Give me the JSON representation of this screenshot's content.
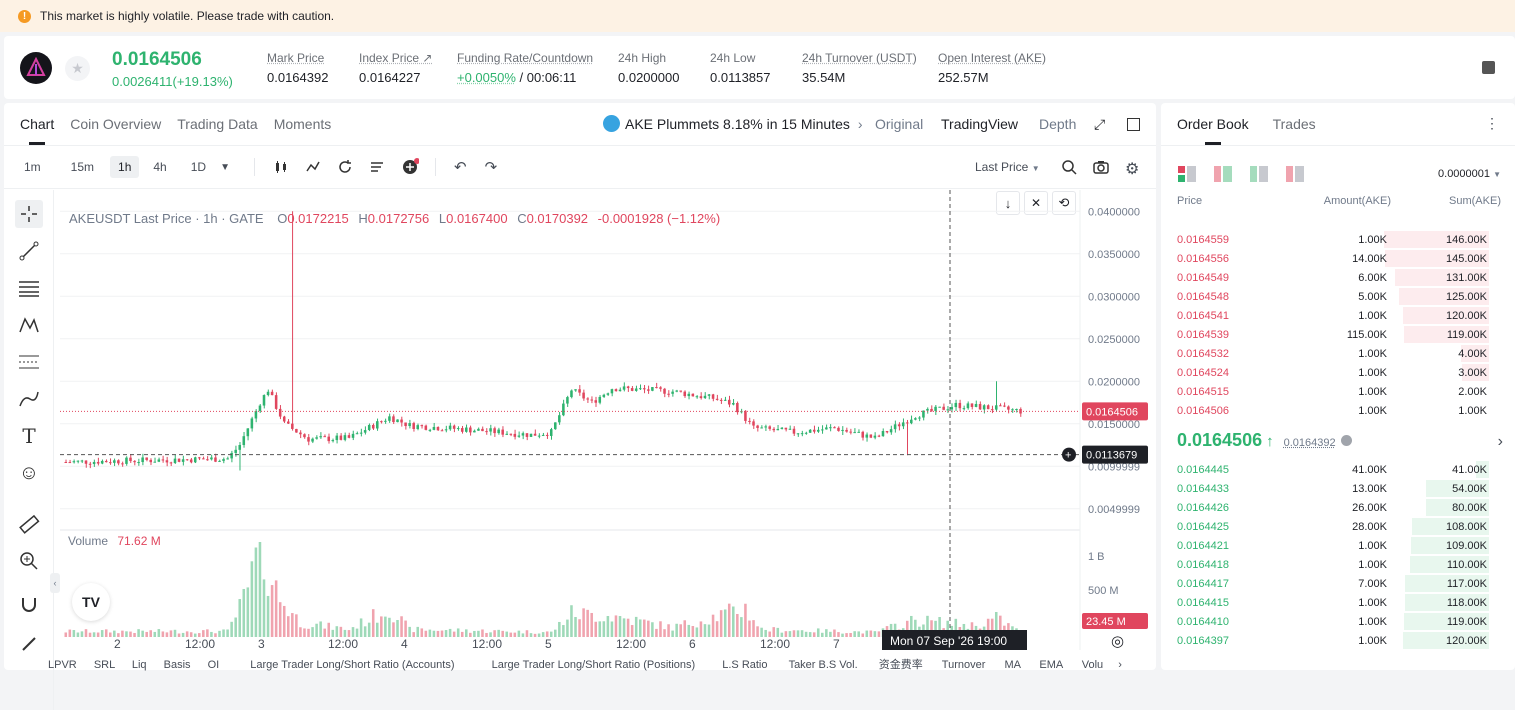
{
  "banner": {
    "text": "This market is highly volatile. Please trade with caution."
  },
  "ticker": {
    "last_price": "0.0164506",
    "change": "0.0026411(+19.13%)",
    "stats": [
      {
        "label": "Mark Price",
        "value": "0.0164392"
      },
      {
        "label": "Index Price ↗",
        "value": "0.0164227"
      },
      {
        "label": "Funding Rate/Countdown",
        "value_pos": "+0.0050%",
        "value_rest": " / 00:06:11"
      },
      {
        "label": "24h High",
        "value": "0.0200000"
      },
      {
        "label": "24h Low",
        "value": "0.0113857"
      },
      {
        "label": "24h Turnover (USDT)",
        "value": "35.54M"
      },
      {
        "label": "Open Interest (AKE)",
        "value": "252.57M"
      }
    ]
  },
  "chart_panel": {
    "tabs": [
      "Chart",
      "Coin Overview",
      "Trading Data",
      "Moments"
    ],
    "news": "AKE Plummets 8.18% in 15 Minutes",
    "view_tabs": [
      "Original",
      "TradingView",
      "Depth"
    ],
    "timeframes": [
      "1m",
      "15m",
      "1h",
      "4h",
      "1D"
    ],
    "price_type": "Last Price"
  },
  "chart_data": {
    "type": "candlestick",
    "symbol": "AKEUSDT Last Price · 1h · GATE",
    "ohlc": {
      "o_label": "O",
      "o": "0.0172215",
      "h_label": "H",
      "h": "0.0172756",
      "l_label": "L",
      "l": "0.0167400",
      "c_label": "C",
      "c": "0.0170392",
      "chg": "-0.0001928 (−1.12%)"
    },
    "y_ticks": [
      "0.0400000",
      "0.0350000",
      "0.0300000",
      "0.0250000",
      "0.0200000",
      "0.0150000",
      "0.0099999",
      "0.0049999"
    ],
    "x_ticks": [
      "2",
      "12:00",
      "3",
      "12:00",
      "4",
      "12:00",
      "5",
      "12:00",
      "6",
      "12:00",
      "7",
      "12:00"
    ],
    "last_price_tag": "0.0164506",
    "cross_price_tag": "0.0113679",
    "cross_time_tag": "Mon 07 Sep '26",
    "cross_time_hour": "19:00",
    "volume_label": "Volume",
    "volume_value": "71.62 M",
    "vol_ticks": [
      "1 B",
      "500 M"
    ],
    "vol_tag": "23.45 M",
    "ylim": [
      0.0025,
      0.0425
    ],
    "anchors": [
      [
        0,
        0.0105
      ],
      [
        40,
        0.0109
      ],
      [
        43,
        0.0125
      ],
      [
        48,
        0.0175
      ],
      [
        50,
        0.019
      ],
      [
        54,
        0.015
      ],
      [
        60,
        0.0132
      ],
      [
        70,
        0.0133
      ],
      [
        80,
        0.0158
      ],
      [
        85,
        0.0148
      ],
      [
        100,
        0.0143
      ],
      [
        115,
        0.0137
      ],
      [
        120,
        0.014
      ],
      [
        125,
        0.019
      ],
      [
        130,
        0.0175
      ],
      [
        135,
        0.0192
      ],
      [
        150,
        0.0188
      ],
      [
        160,
        0.018
      ],
      [
        165,
        0.0173
      ],
      [
        170,
        0.0145
      ],
      [
        180,
        0.014
      ],
      [
        190,
        0.0145
      ],
      [
        200,
        0.0133
      ],
      [
        210,
        0.016
      ],
      [
        220,
        0.0172
      ],
      [
        230,
        0.0168
      ],
      [
        236,
        0.0165
      ]
    ],
    "volume_anchors": [
      [
        0,
        0.06
      ],
      [
        40,
        0.06
      ],
      [
        43,
        0.3
      ],
      [
        45,
        0.5
      ],
      [
        48,
        0.95
      ],
      [
        50,
        0.7
      ],
      [
        53,
        0.4
      ],
      [
        58,
        0.15
      ],
      [
        70,
        0.08
      ],
      [
        80,
        0.3
      ],
      [
        85,
        0.08
      ],
      [
        120,
        0.05
      ],
      [
        125,
        0.25
      ],
      [
        135,
        0.22
      ],
      [
        150,
        0.1
      ],
      [
        168,
        0.3
      ],
      [
        172,
        0.08
      ],
      [
        200,
        0.05
      ],
      [
        210,
        0.18
      ],
      [
        225,
        0.12
      ],
      [
        230,
        0.2
      ],
      [
        236,
        0.05
      ]
    ]
  },
  "bottom_tools": [
    "LPVR",
    "SRL",
    "Liq",
    "Basis",
    "OI",
    "Large Trader Long/Short Ratio (Accounts)",
    "Large Trader Long/Short Ratio (Positions)",
    "L.S Ratio",
    "Taker B.S Vol.",
    "资金费率",
    "Turnover",
    "MA",
    "EMA",
    "Volu"
  ],
  "orderbook": {
    "tabs": [
      "Order Book",
      "Trades"
    ],
    "precision": "0.0000001",
    "headers": [
      "Price",
      "Amount(AKE)",
      "Sum(AKE)"
    ],
    "asks": [
      {
        "p": "0.0164559",
        "a": "1.00K",
        "s": "146.00K",
        "depth": 1.0
      },
      {
        "p": "0.0164556",
        "a": "14.00K",
        "s": "145.00K",
        "depth": 0.99
      },
      {
        "p": "0.0164549",
        "a": "6.00K",
        "s": "131.00K",
        "depth": 0.9
      },
      {
        "p": "0.0164548",
        "a": "5.00K",
        "s": "125.00K",
        "depth": 0.86
      },
      {
        "p": "0.0164541",
        "a": "1.00K",
        "s": "120.00K",
        "depth": 0.82
      },
      {
        "p": "0.0164539",
        "a": "115.00K",
        "s": "119.00K",
        "depth": 0.81
      },
      {
        "p": "0.0164532",
        "a": "1.00K",
        "s": "4.00K",
        "depth": 0.27
      },
      {
        "p": "0.0164524",
        "a": "1.00K",
        "s": "3.00K",
        "depth": 0.26
      },
      {
        "p": "0.0164515",
        "a": "1.00K",
        "s": "2.00K",
        "depth": 0.0
      },
      {
        "p": "0.0164506",
        "a": "1.00K",
        "s": "1.00K",
        "depth": 0.0
      }
    ],
    "mid_price": "0.0164506",
    "mid_arrow": "↑",
    "mark_price": "0.0164392",
    "bids": [
      {
        "p": "0.0164445",
        "a": "41.00K",
        "s": "41.00K",
        "depth": 0.12
      },
      {
        "p": "0.0164433",
        "a": "13.00K",
        "s": "54.00K",
        "depth": 0.6
      },
      {
        "p": "0.0164426",
        "a": "26.00K",
        "s": "80.00K",
        "depth": 0.6
      },
      {
        "p": "0.0164425",
        "a": "28.00K",
        "s": "108.00K",
        "depth": 0.73
      },
      {
        "p": "0.0164421",
        "a": "1.00K",
        "s": "109.00K",
        "depth": 0.74
      },
      {
        "p": "0.0164418",
        "a": "1.00K",
        "s": "110.00K",
        "depth": 0.75
      },
      {
        "p": "0.0164417",
        "a": "7.00K",
        "s": "117.00K",
        "depth": 0.8
      },
      {
        "p": "0.0164415",
        "a": "1.00K",
        "s": "118.00K",
        "depth": 0.8
      },
      {
        "p": "0.0164410",
        "a": "1.00K",
        "s": "119.00K",
        "depth": 0.81
      },
      {
        "p": "0.0164397",
        "a": "1.00K",
        "s": "120.00K",
        "depth": 0.82
      }
    ]
  },
  "colors": {
    "up": "#2eb36f",
    "down": "#e0465e",
    "ask_bg": "#fdecee",
    "bid_bg": "#e8f7ee"
  }
}
